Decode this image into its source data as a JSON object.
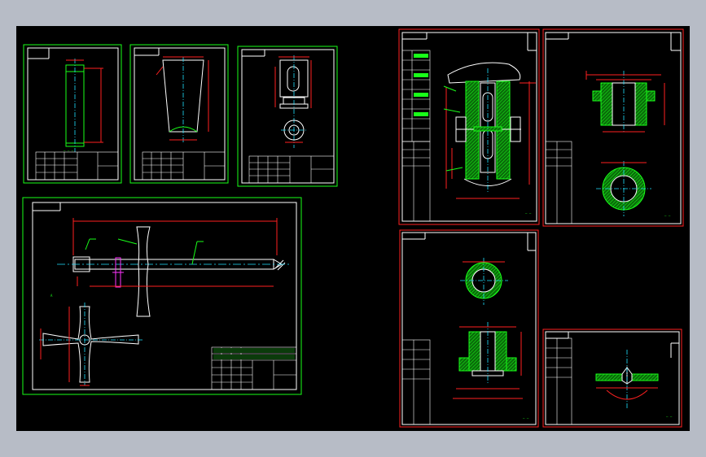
{
  "viewer": {
    "background": "#b7bcc6",
    "canvas_color": "#000000"
  },
  "colors": {
    "sheet_border_green": "#19ff19",
    "sheet_border_red": "#ff2020",
    "line_white": "#ffffff",
    "line_magenta": "#ff33ff",
    "center_cyan": "#20e0ff"
  },
  "sheets": [
    {
      "id": "sheet-1",
      "border": "green"
    },
    {
      "id": "sheet-2",
      "border": "green"
    },
    {
      "id": "sheet-3",
      "border": "green"
    },
    {
      "id": "sheet-4",
      "border": "green"
    },
    {
      "id": "sheet-5",
      "border": "red"
    },
    {
      "id": "sheet-6",
      "border": "red"
    },
    {
      "id": "sheet-7",
      "border": "red"
    },
    {
      "id": "sheet-8",
      "border": "red"
    }
  ]
}
